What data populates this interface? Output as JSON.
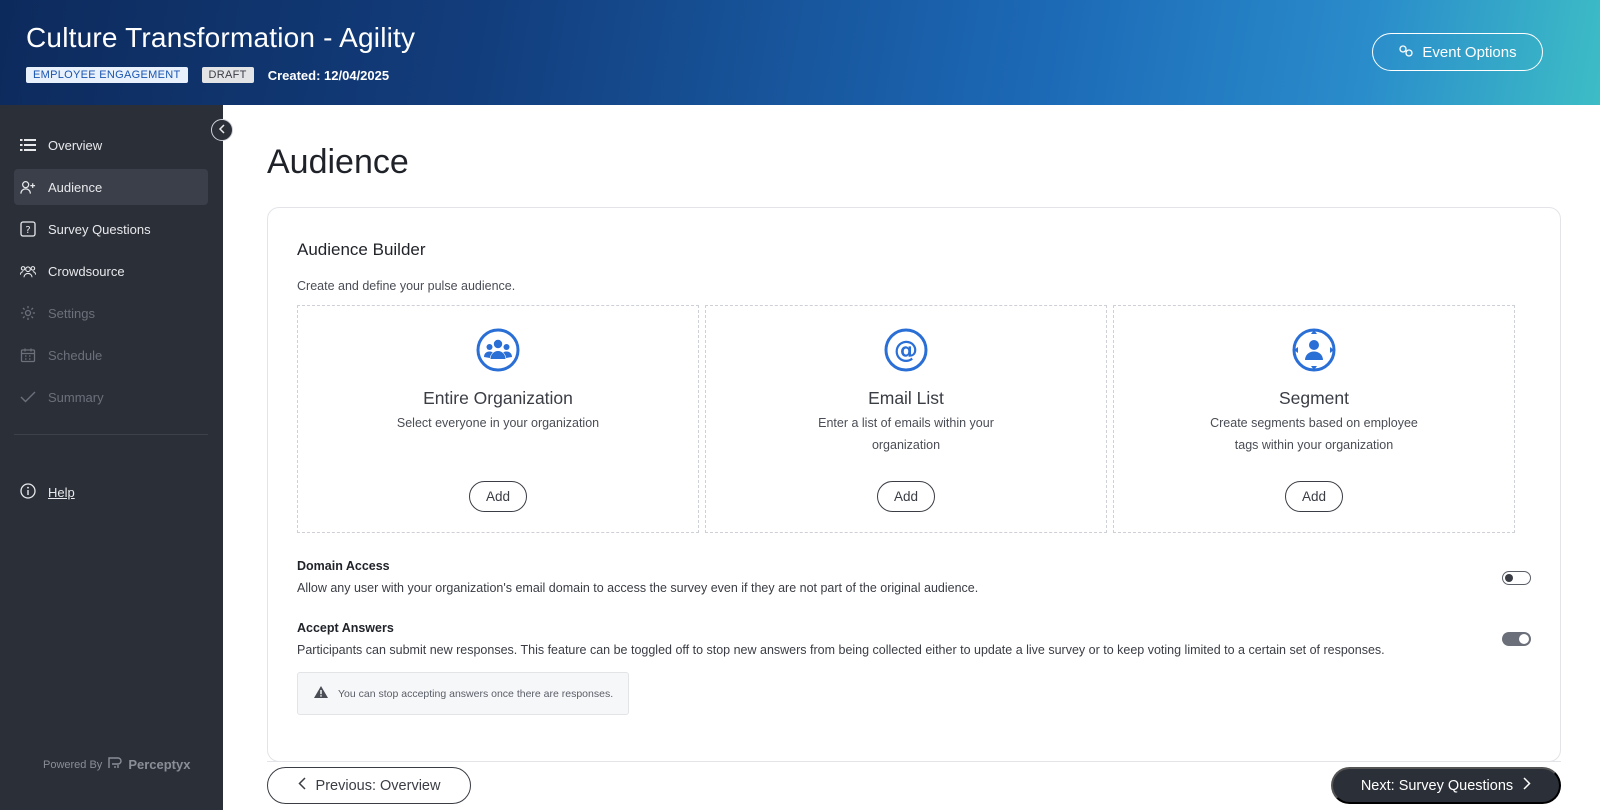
{
  "header": {
    "title": "Culture Transformation - Agility",
    "badge_type": "EMPLOYEE ENGAGEMENT",
    "badge_status": "DRAFT",
    "created": "Created: 12/04/2025",
    "event_options_label": "Event Options"
  },
  "sidebar": {
    "items": [
      {
        "label": "Overview",
        "icon": "list-icon",
        "state": "normal"
      },
      {
        "label": "Audience",
        "icon": "user-plus-icon",
        "state": "active"
      },
      {
        "label": "Survey Questions",
        "icon": "question-box-icon",
        "state": "normal"
      },
      {
        "label": "Crowdsource",
        "icon": "people-icon",
        "state": "normal"
      },
      {
        "label": "Settings",
        "icon": "gear-icon",
        "state": "disabled"
      },
      {
        "label": "Schedule",
        "icon": "calendar-icon",
        "state": "disabled"
      },
      {
        "label": "Summary",
        "icon": "check-icon",
        "state": "disabled"
      }
    ],
    "help_label": "Help",
    "powered_by": "Powered By",
    "brand": "Perceptyx"
  },
  "main": {
    "page_title": "Audience",
    "builder_title": "Audience Builder",
    "builder_subtitle": "Create and define your pulse audience.",
    "options": [
      {
        "title": "Entire Organization",
        "desc": "Select everyone in your organization",
        "button": "Add",
        "icon": "organization-icon"
      },
      {
        "title": "Email List",
        "desc": "Enter a list of emails within your organization",
        "button": "Add",
        "icon": "at-sign-icon"
      },
      {
        "title": "Segment",
        "desc": "Create segments based on employee tags within your organization",
        "button": "Add",
        "icon": "segment-icon"
      }
    ],
    "domain_access": {
      "title": "Domain Access",
      "desc": "Allow any user with your organization's email domain to access the survey even if they are not part of the original audience.",
      "enabled": false
    },
    "accept_answers": {
      "title": "Accept Answers",
      "desc": "Participants can submit new responses. This feature can be toggled off to stop new answers from being collected either to update a live survey or to keep voting limited to a certain set of responses.",
      "enabled": true
    },
    "notice": "You can stop accepting answers once there are responses."
  },
  "footer": {
    "prev_label": "Previous: Overview",
    "next_label": "Next: Survey Questions"
  },
  "colors": {
    "accent_blue": "#2a6fd6",
    "sidebar_bg": "#2b2f38",
    "primary_dark": "#2b2f38"
  }
}
